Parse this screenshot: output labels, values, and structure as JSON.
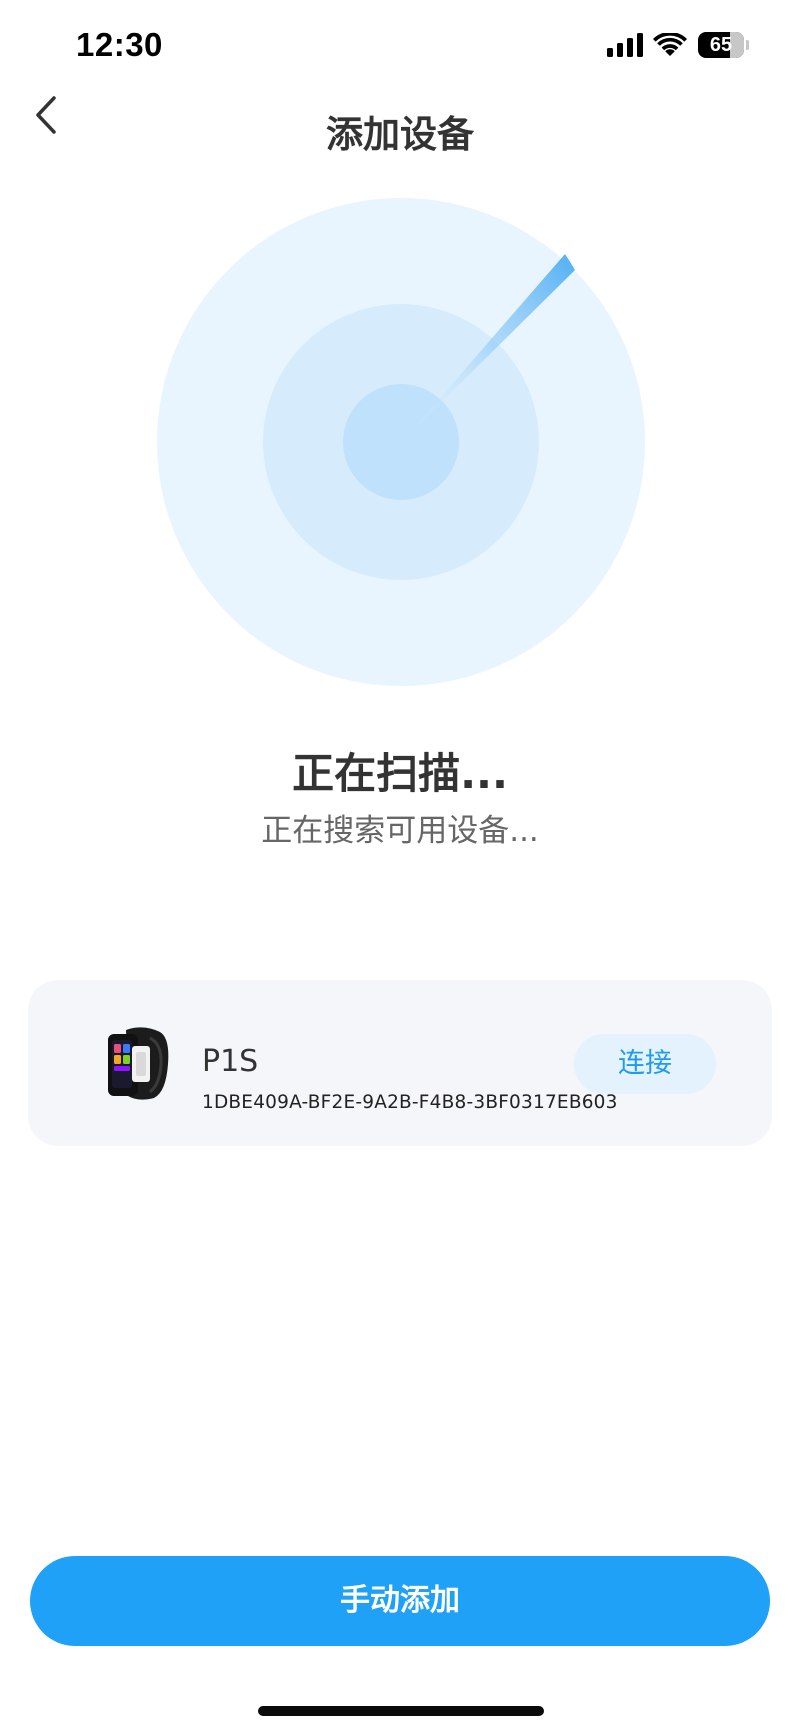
{
  "status_bar": {
    "time": "12:30",
    "battery_level": "65"
  },
  "nav": {
    "title": "添加设备"
  },
  "scan": {
    "title": "正在扫描...",
    "subtitle": "正在搜索可用设备..."
  },
  "devices": [
    {
      "name": "P1S",
      "id": "1DBE409A-BF2E-9A2B-F4B8-3BF0317EB603",
      "action_label": "连接"
    }
  ],
  "footer": {
    "manual_add_label": "手动添加"
  },
  "colors": {
    "accent": "#1ea1f7",
    "connect_text": "#1e9bf0",
    "connect_bg": "#e3f2fd",
    "card_bg": "#f5f6fa",
    "radar_outer": "#e9f5fe",
    "radar_middle": "#d6ecfd",
    "radar_inner": "#bfe1fb"
  }
}
